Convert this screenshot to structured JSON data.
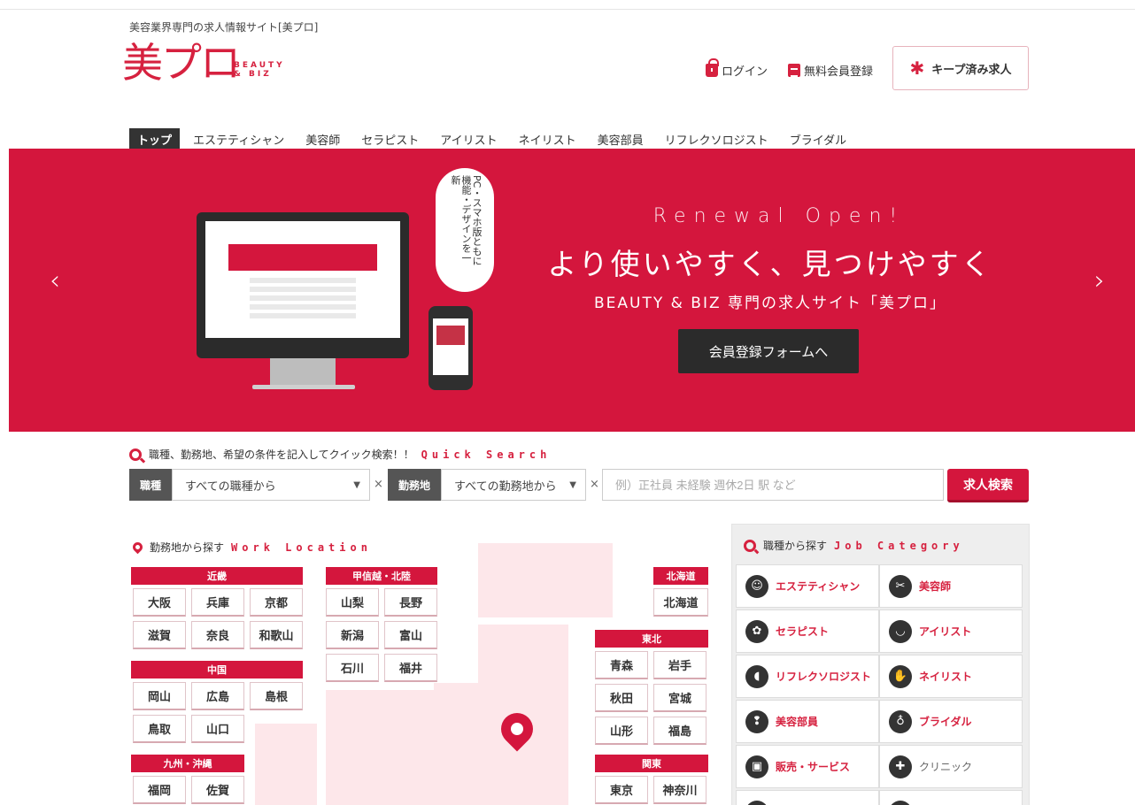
{
  "header": {
    "tagline": "美容業界専門の求人情報サイト[美プロ]",
    "logo_main": "美プロ",
    "logo_sub_line1": "BEAUTY",
    "logo_sub_line2": "& BIZ",
    "login_label": "ログイン",
    "register_label": "無料会員登録",
    "keep_label": "キープ済み求人"
  },
  "nav": {
    "items": [
      "トップ",
      "エステティシャン",
      "美容師",
      "セラピスト",
      "アイリスト",
      "ネイリスト",
      "美容部員",
      "リフレクソロジスト",
      "ブライダル"
    ],
    "active_index": 0
  },
  "hero": {
    "bubble_text": "PC・スマホ版ともに機能・デザインを一新",
    "renewal_text": "Renewal Open!",
    "headline": "より使いやすく、見つけやすく",
    "subline": "BEAUTY & BIZ 専門の求人サイト「美プロ」",
    "cta_label": "会員登録フォームへ",
    "prev_arrow": "‹",
    "next_arrow": "›",
    "bg_color": "#d4163d"
  },
  "quick_search": {
    "title": "職種、勤務地、希望の条件を記入してクイック検索！！",
    "title_en": "Quick Search",
    "job_tag": "職種",
    "job_select_value": "すべての職種から",
    "location_tag": "勤務地",
    "location_select_value": "すべての勤務地から",
    "separator": "×",
    "keyword_placeholder": "例）正社員 未経験 週休2日 駅 など",
    "search_button": "求人検索"
  },
  "work_location": {
    "title": "勤務地から探す",
    "title_en": "Work Location",
    "regions": {
      "kinki": {
        "name": "近畿",
        "prefs": [
          "大阪",
          "兵庫",
          "京都",
          "滋賀",
          "奈良",
          "和歌山"
        ]
      },
      "chugoku": {
        "name": "中国",
        "prefs": [
          "岡山",
          "広島",
          "島根",
          "鳥取",
          "山口"
        ]
      },
      "kyushu": {
        "name": "九州・沖縄",
        "prefs": [
          "福岡",
          "佐賀"
        ]
      },
      "koshinetsu": {
        "name": "甲信越・北陸",
        "prefs": [
          "山梨",
          "長野",
          "新潟",
          "富山",
          "石川",
          "福井"
        ]
      },
      "hokkaido": {
        "name": "北海道",
        "prefs": [
          "北海道"
        ]
      },
      "tohoku": {
        "name": "東北",
        "prefs": [
          "青森",
          "岩手",
          "秋田",
          "宮城",
          "山形",
          "福島"
        ]
      },
      "kanto": {
        "name": "関東",
        "prefs": [
          "東京",
          "神奈川"
        ]
      }
    }
  },
  "job_category": {
    "title": "職種から探す",
    "title_en": "Job Category",
    "items": [
      {
        "label": "エステティシャン",
        "icon": "face-icon"
      },
      {
        "label": "美容師",
        "icon": "scissors-icon"
      },
      {
        "label": "セラピスト",
        "icon": "flower-icon"
      },
      {
        "label": "アイリスト",
        "icon": "eyelash-icon"
      },
      {
        "label": "リフレクソロジスト",
        "icon": "foot-icon"
      },
      {
        "label": "ネイリスト",
        "icon": "hand-icon"
      },
      {
        "label": "美容部員",
        "icon": "lipstick-icon"
      },
      {
        "label": "ブライダル",
        "icon": "dress-icon"
      },
      {
        "label": "販売・サービス",
        "icon": "bag-icon"
      },
      {
        "label": "クリニック",
        "icon": "cross-icon"
      }
    ]
  }
}
